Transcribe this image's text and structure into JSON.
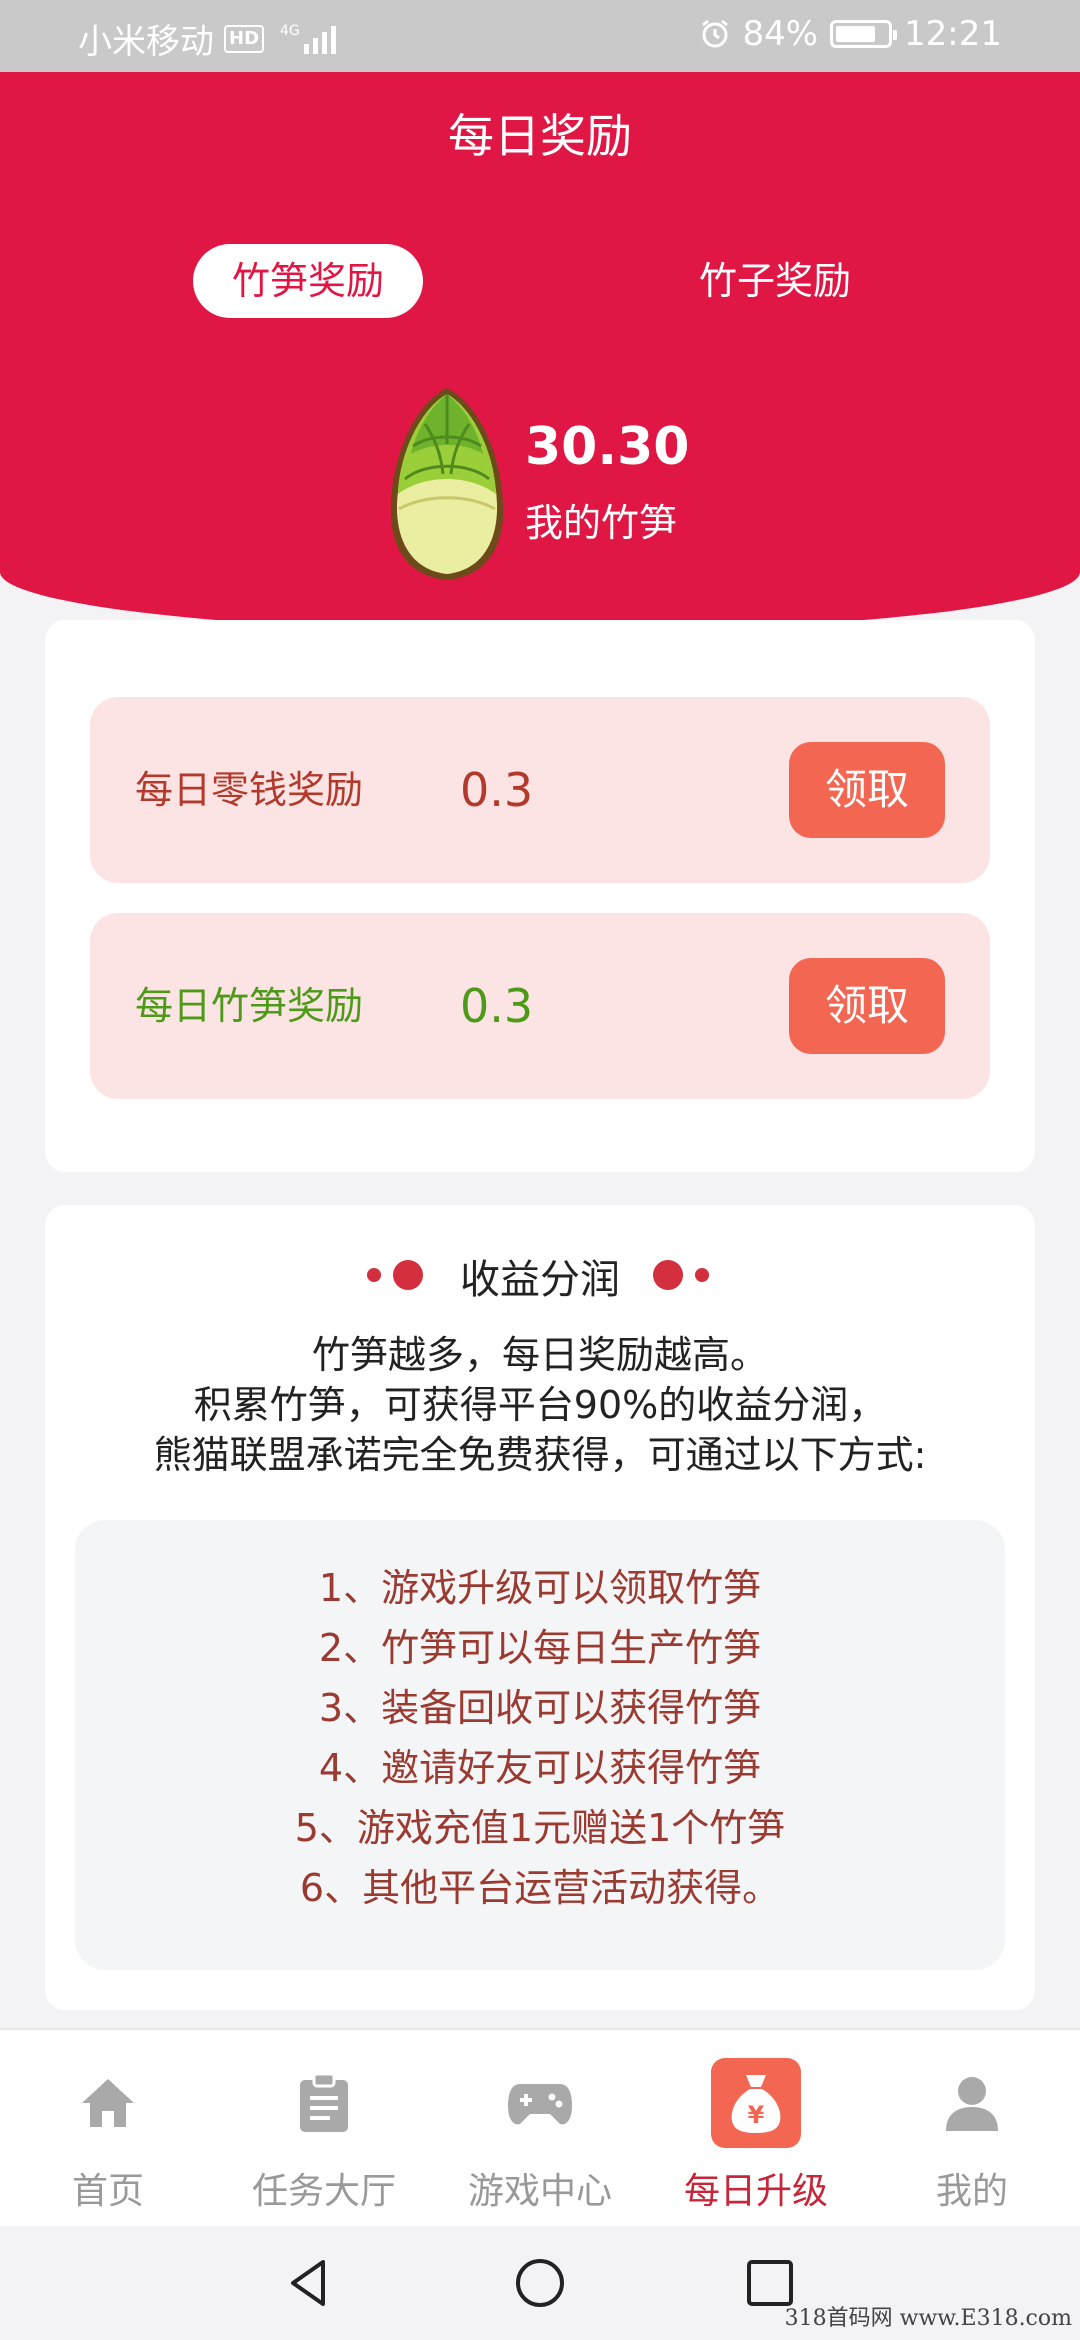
{
  "status_bar": {
    "carrier": "小米移动",
    "hd": "HD",
    "network": "4G",
    "battery": "84%",
    "time": "12:21"
  },
  "header": {
    "title": "每日奖励",
    "tabs": [
      {
        "label": "竹笋奖励",
        "active": true
      },
      {
        "label": "竹子奖励",
        "active": false
      }
    ],
    "balance_value": "30.30",
    "balance_label": "我的竹笋"
  },
  "rewards": [
    {
      "label": "每日零钱奖励",
      "amount": "0.3",
      "button": "领取"
    },
    {
      "label": "每日竹笋奖励",
      "amount": "0.3",
      "button": "领取"
    }
  ],
  "profit_share": {
    "title": "收益分润",
    "description": [
      "竹笋越多，每日奖励越高。",
      "积累竹笋，可获得平台90%的收益分润，",
      "熊猫联盟承诺完全免费获得，可通过以下方式:"
    ],
    "ways": [
      "1、游戏升级可以领取竹笋",
      "2、竹笋可以每日生产竹笋",
      "3、装备回收可以获得竹笋",
      "4、邀请好友可以获得竹笋",
      "5、游戏充值1元赠送1个竹笋",
      "6、其他平台运营活动获得。"
    ]
  },
  "bottom_nav": [
    {
      "label": "首页",
      "icon": "home-icon",
      "active": false
    },
    {
      "label": "任务大厅",
      "icon": "clipboard-icon",
      "active": false
    },
    {
      "label": "游戏中心",
      "icon": "gamepad-icon",
      "active": false
    },
    {
      "label": "每日升级",
      "icon": "money-bag-icon",
      "active": true
    },
    {
      "label": "我的",
      "icon": "user-icon",
      "active": false
    }
  ],
  "watermark": "318首码网 www.E318.com",
  "colors": {
    "header_red": "#e01744",
    "claim_button": "#f26652",
    "cash_text": "#b23a2c",
    "shoot_text": "#4c9a17",
    "active_nav": "#c5263a"
  }
}
